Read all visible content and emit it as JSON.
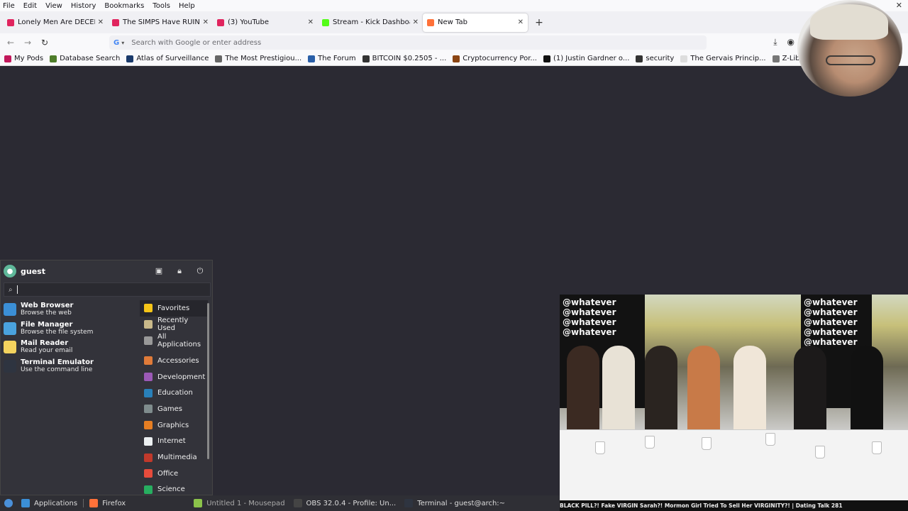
{
  "menubar": [
    "File",
    "Edit",
    "View",
    "History",
    "Bookmarks",
    "Tools",
    "Help"
  ],
  "tabs": [
    {
      "title": "Lonely Men Are DECENT",
      "color": "#e0245e"
    },
    {
      "title": "The SIMPS Have RUINED",
      "color": "#e0245e"
    },
    {
      "title": "(3) YouTube",
      "color": "#e0245e"
    },
    {
      "title": "Stream - Kick Dashboard",
      "color": "#53fc18"
    },
    {
      "title": "New Tab",
      "color": "#ff7139",
      "active": true
    }
  ],
  "url": {
    "placeholder": "Search with Google or enter address"
  },
  "bookmarks": [
    {
      "label": "My Pods",
      "color": "#c2185b"
    },
    {
      "label": "Database Search",
      "color": "#4e7d2a"
    },
    {
      "label": "Atlas of Surveillance",
      "color": "#1a3a6b"
    },
    {
      "label": "The Most Prestigiou...",
      "color": "#666"
    },
    {
      "label": "The Forum",
      "color": "#2a5fa8"
    },
    {
      "label": "BITCOIN $0.2505 - ...",
      "color": "#333"
    },
    {
      "label": "Cryptocurrency Por...",
      "color": "#8b4513"
    },
    {
      "label": "(1) Justin Gardner o...",
      "color": "#111"
    },
    {
      "label": "security",
      "color": "#333"
    },
    {
      "label": "The Gervais Princip...",
      "color": "#ddd"
    },
    {
      "label": "Z-Library – the worl...",
      "color": "#777"
    }
  ],
  "whisker": {
    "user": "guest",
    "favorites": [
      {
        "name": "Web Browser",
        "desc": "Browse the web",
        "color": "#3b8fd6"
      },
      {
        "name": "File Manager",
        "desc": "Browse the file system",
        "color": "#4aa3df"
      },
      {
        "name": "Mail Reader",
        "desc": "Read your email",
        "color": "#f4d35e"
      },
      {
        "name": "Terminal Emulator",
        "desc": "Use the command line",
        "color": "#2e3440"
      }
    ],
    "categories": [
      {
        "label": "Favorites",
        "color": "#f5c518",
        "selected": true
      },
      {
        "label": "Recently Used",
        "color": "#c9b98a"
      },
      {
        "label": "All Applications",
        "color": "#999"
      },
      {
        "label": "Accessories",
        "color": "#e07b39"
      },
      {
        "label": "Development",
        "color": "#9b59b6"
      },
      {
        "label": "Education",
        "color": "#2980b9"
      },
      {
        "label": "Games",
        "color": "#7f8c8d"
      },
      {
        "label": "Graphics",
        "color": "#e67e22"
      },
      {
        "label": "Internet",
        "color": "#ecf0f1"
      },
      {
        "label": "Multimedia",
        "color": "#c0392b"
      },
      {
        "label": "Office",
        "color": "#e74c3c"
      },
      {
        "label": "Science",
        "color": "#27ae60"
      }
    ]
  },
  "video": {
    "wall_text": "@whatever",
    "caption": "BLACK PILL?! Fake VIRGIN Sarah?! Mormon Girl Tried To Sell Her VIRGINITY?! | Dating Talk 281"
  },
  "taskbar": [
    {
      "label": "Applications",
      "color": "#3b8fd6"
    },
    {
      "label": "Firefox",
      "color": "#ff7139"
    },
    {
      "label": "Untitled 1 - Mousepad",
      "color": "#8bc34a",
      "dim": true
    },
    {
      "label": "OBS 32.0.4 - Profile: Un...",
      "color": "#444"
    },
    {
      "label": "Terminal - guest@arch:~",
      "color": "#2e3440"
    }
  ]
}
